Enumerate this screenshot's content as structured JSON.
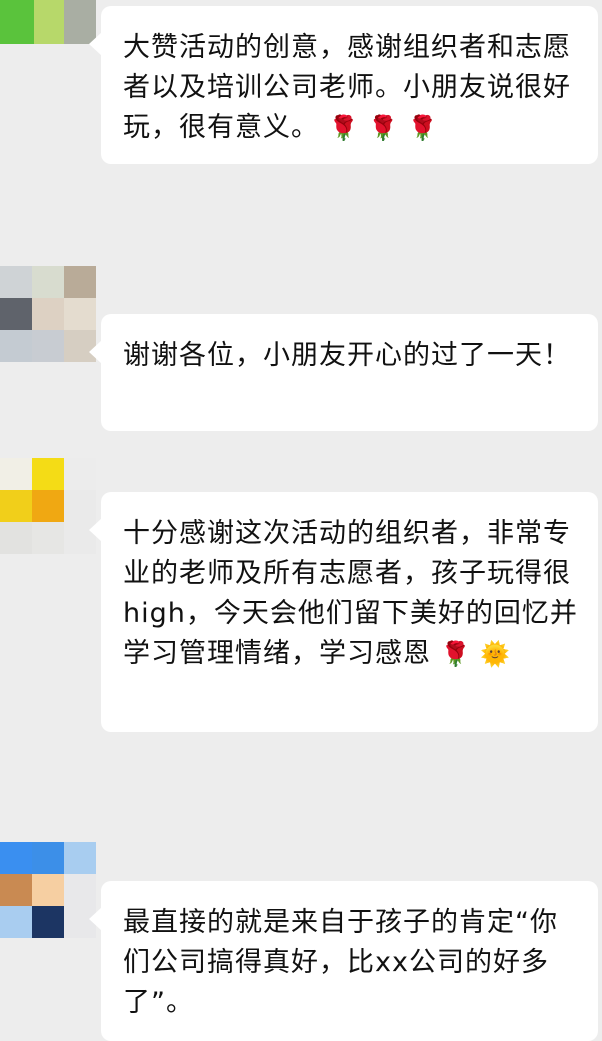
{
  "messages": [
    {
      "text": "大赞活动的创意，感谢组织者和志愿者以及培训公司老师。小朋友说很好玩，很有意义。",
      "emoji": "🌹 🌹 🌹"
    },
    {
      "text": "谢谢各位，小朋友开心的过了一天！",
      "emoji": ""
    },
    {
      "text": "十分感谢这次活动的组织者，非常专业的老师及所有志愿者，孩子玩得很high，今天会他们留下美好的回忆并学习管理情绪，学习感恩",
      "emoji": "🌹 🌞"
    },
    {
      "text": "最直接的就是来自于孩子的肯定“你们公司搞得真好，比xx公司的好多了”。",
      "emoji": ""
    }
  ]
}
